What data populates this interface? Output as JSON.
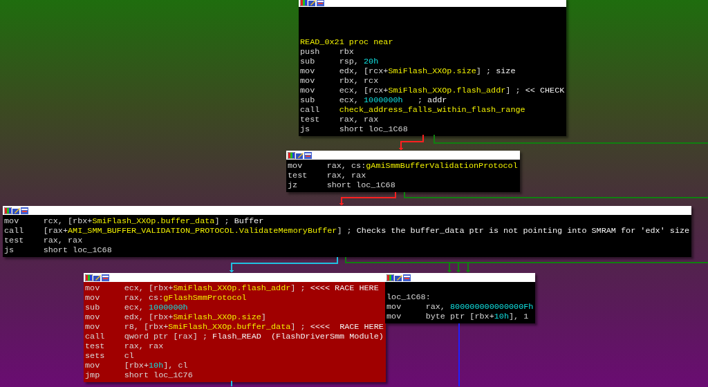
{
  "nodes": [
    {
      "kind": "normal",
      "lines": [
        {
          "kind": "label",
          "segments": [
            {
              "kind": "name",
              "text": "READ_0x21 proc near"
            }
          ]
        },
        {
          "kind": "insn",
          "mnemonic": "push",
          "segments": [
            {
              "kind": "plain",
              "text": "rbx"
            }
          ]
        },
        {
          "kind": "insn",
          "mnemonic": "sub",
          "segments": [
            {
              "kind": "plain",
              "text": "rsp, "
            },
            {
              "kind": "num",
              "text": "20h"
            }
          ]
        },
        {
          "kind": "insn",
          "mnemonic": "mov",
          "segments": [
            {
              "kind": "plain",
              "text": "edx, [rcx+"
            },
            {
              "kind": "name",
              "text": "SmiFlash_XXOp.size"
            },
            {
              "kind": "plain",
              "text": "] ; "
            },
            {
              "kind": "comment",
              "text": "size"
            }
          ]
        },
        {
          "kind": "insn",
          "mnemonic": "mov",
          "segments": [
            {
              "kind": "plain",
              "text": "rbx, rcx"
            }
          ]
        },
        {
          "kind": "insn",
          "mnemonic": "mov",
          "segments": [
            {
              "kind": "plain",
              "text": "ecx, [rcx+"
            },
            {
              "kind": "name",
              "text": "SmiFlash_XXOp.flash_addr"
            },
            {
              "kind": "plain",
              "text": "] ; "
            },
            {
              "kind": "comment",
              "text": "<< CHECK"
            }
          ]
        },
        {
          "kind": "insn",
          "mnemonic": "sub",
          "segments": [
            {
              "kind": "plain",
              "text": "ecx, "
            },
            {
              "kind": "num",
              "text": "1000000h"
            },
            {
              "kind": "plain",
              "text": "   ; "
            },
            {
              "kind": "comment",
              "text": "addr"
            }
          ]
        },
        {
          "kind": "insn",
          "mnemonic": "call",
          "segments": [
            {
              "kind": "name",
              "text": "check_address_falls_within_flash_range"
            }
          ]
        },
        {
          "kind": "insn",
          "mnemonic": "test",
          "segments": [
            {
              "kind": "plain",
              "text": "rax, rax"
            }
          ]
        },
        {
          "kind": "insn",
          "mnemonic": "js",
          "segments": [
            {
              "kind": "plain",
              "text": "short loc_1C68"
            }
          ]
        }
      ]
    },
    {
      "kind": "normal",
      "lines": [
        {
          "kind": "insn",
          "mnemonic": "mov",
          "segments": [
            {
              "kind": "plain",
              "text": "rax, cs:"
            },
            {
              "kind": "name",
              "text": "gAmiSmmBufferValidationProtocol"
            }
          ]
        },
        {
          "kind": "insn",
          "mnemonic": "test",
          "segments": [
            {
              "kind": "plain",
              "text": "rax, rax"
            }
          ]
        },
        {
          "kind": "insn",
          "mnemonic": "jz",
          "segments": [
            {
              "kind": "plain",
              "text": "short loc_1C68"
            }
          ]
        }
      ]
    },
    {
      "kind": "normal",
      "lines": [
        {
          "kind": "insn",
          "mnemonic": "mov",
          "segments": [
            {
              "kind": "plain",
              "text": "rcx, [rbx+"
            },
            {
              "kind": "name",
              "text": "SmiFlash_XXOp.buffer_data"
            },
            {
              "kind": "plain",
              "text": "] ; "
            },
            {
              "kind": "comment",
              "text": "Buffer"
            }
          ]
        },
        {
          "kind": "insn",
          "mnemonic": "call",
          "segments": [
            {
              "kind": "plain",
              "text": "[rax+"
            },
            {
              "kind": "name",
              "text": "AMI_SMM_BUFFER_VALIDATION_PROTOCOL.ValidateMemoryBuffer"
            },
            {
              "kind": "plain",
              "text": "] ; "
            },
            {
              "kind": "comment",
              "text": "Checks the buffer_data ptr is not pointing into SMRAM for 'edx' size"
            }
          ]
        },
        {
          "kind": "insn",
          "mnemonic": "test",
          "segments": [
            {
              "kind": "plain",
              "text": "rax, rax"
            }
          ]
        },
        {
          "kind": "insn",
          "mnemonic": "js",
          "segments": [
            {
              "kind": "plain",
              "text": "short loc_1C68"
            }
          ]
        }
      ]
    },
    {
      "kind": "highlight",
      "lines": [
        {
          "kind": "insn",
          "mnemonic": "mov",
          "segments": [
            {
              "kind": "plain",
              "text": "ecx, [rbx+"
            },
            {
              "kind": "name",
              "text": "SmiFlash_XXOp.flash_addr"
            },
            {
              "kind": "plain",
              "text": "] ; "
            },
            {
              "kind": "comment",
              "text": "<<<< RACE HERE"
            }
          ]
        },
        {
          "kind": "insn",
          "mnemonic": "mov",
          "segments": [
            {
              "kind": "plain",
              "text": "rax, cs:"
            },
            {
              "kind": "name",
              "text": "gFlashSmmProtocol"
            }
          ]
        },
        {
          "kind": "insn",
          "mnemonic": "sub",
          "segments": [
            {
              "kind": "plain",
              "text": "ecx, "
            },
            {
              "kind": "num",
              "text": "1000000h"
            }
          ]
        },
        {
          "kind": "insn",
          "mnemonic": "mov",
          "segments": [
            {
              "kind": "plain",
              "text": "edx, [rbx+"
            },
            {
              "kind": "name",
              "text": "SmiFlash_XXOp.size"
            },
            {
              "kind": "plain",
              "text": "]"
            }
          ]
        },
        {
          "kind": "insn",
          "mnemonic": "mov",
          "segments": [
            {
              "kind": "plain",
              "text": "r8, [rbx+"
            },
            {
              "kind": "name",
              "text": "SmiFlash_XXOp.buffer_data"
            },
            {
              "kind": "plain",
              "text": "] ; "
            },
            {
              "kind": "comment",
              "text": "<<<<  RACE HERE"
            }
          ]
        },
        {
          "kind": "insn",
          "mnemonic": "call",
          "segments": [
            {
              "kind": "plain",
              "text": "qword ptr [rax] ; "
            },
            {
              "kind": "comment",
              "text": "Flash_READ  (FlashDriverSmm Module)"
            }
          ]
        },
        {
          "kind": "insn",
          "mnemonic": "test",
          "segments": [
            {
              "kind": "plain",
              "text": "rax, rax"
            }
          ]
        },
        {
          "kind": "insn",
          "mnemonic": "sets",
          "segments": [
            {
              "kind": "plain",
              "text": "cl"
            }
          ]
        },
        {
          "kind": "insn",
          "mnemonic": "mov",
          "segments": [
            {
              "kind": "plain",
              "text": "[rbx+"
            },
            {
              "kind": "num",
              "text": "10h"
            },
            {
              "kind": "plain",
              "text": "], cl"
            }
          ]
        },
        {
          "kind": "insn",
          "mnemonic": "jmp",
          "segments": [
            {
              "kind": "plain",
              "text": "short loc_1C76"
            }
          ]
        }
      ]
    },
    {
      "kind": "normal",
      "lines": [
        {
          "kind": "label",
          "segments": [
            {
              "kind": "plain",
              "text": "loc_1C68:"
            }
          ]
        },
        {
          "kind": "insn",
          "mnemonic": "mov",
          "segments": [
            {
              "kind": "plain",
              "text": "rax, "
            },
            {
              "kind": "num",
              "text": "800000000000000Fh"
            }
          ]
        },
        {
          "kind": "insn",
          "mnemonic": "mov",
          "segments": [
            {
              "kind": "plain",
              "text": "byte ptr [rbx+"
            },
            {
              "kind": "num",
              "text": "10h"
            },
            {
              "kind": "plain",
              "text": "], 1"
            }
          ]
        }
      ]
    }
  ],
  "edges": [
    {
      "color": "#ff2020"
    },
    {
      "color": "#108010"
    },
    {
      "color": "#108010"
    },
    {
      "color": "#ff2020"
    },
    {
      "color": "#108010"
    },
    {
      "color": "#20c0e0"
    },
    {
      "color": "#108010"
    },
    {
      "color": "#108010"
    },
    {
      "color": "#108010"
    },
    {
      "color": "#2020ff"
    },
    {
      "color": "#20c0e0"
    }
  ]
}
